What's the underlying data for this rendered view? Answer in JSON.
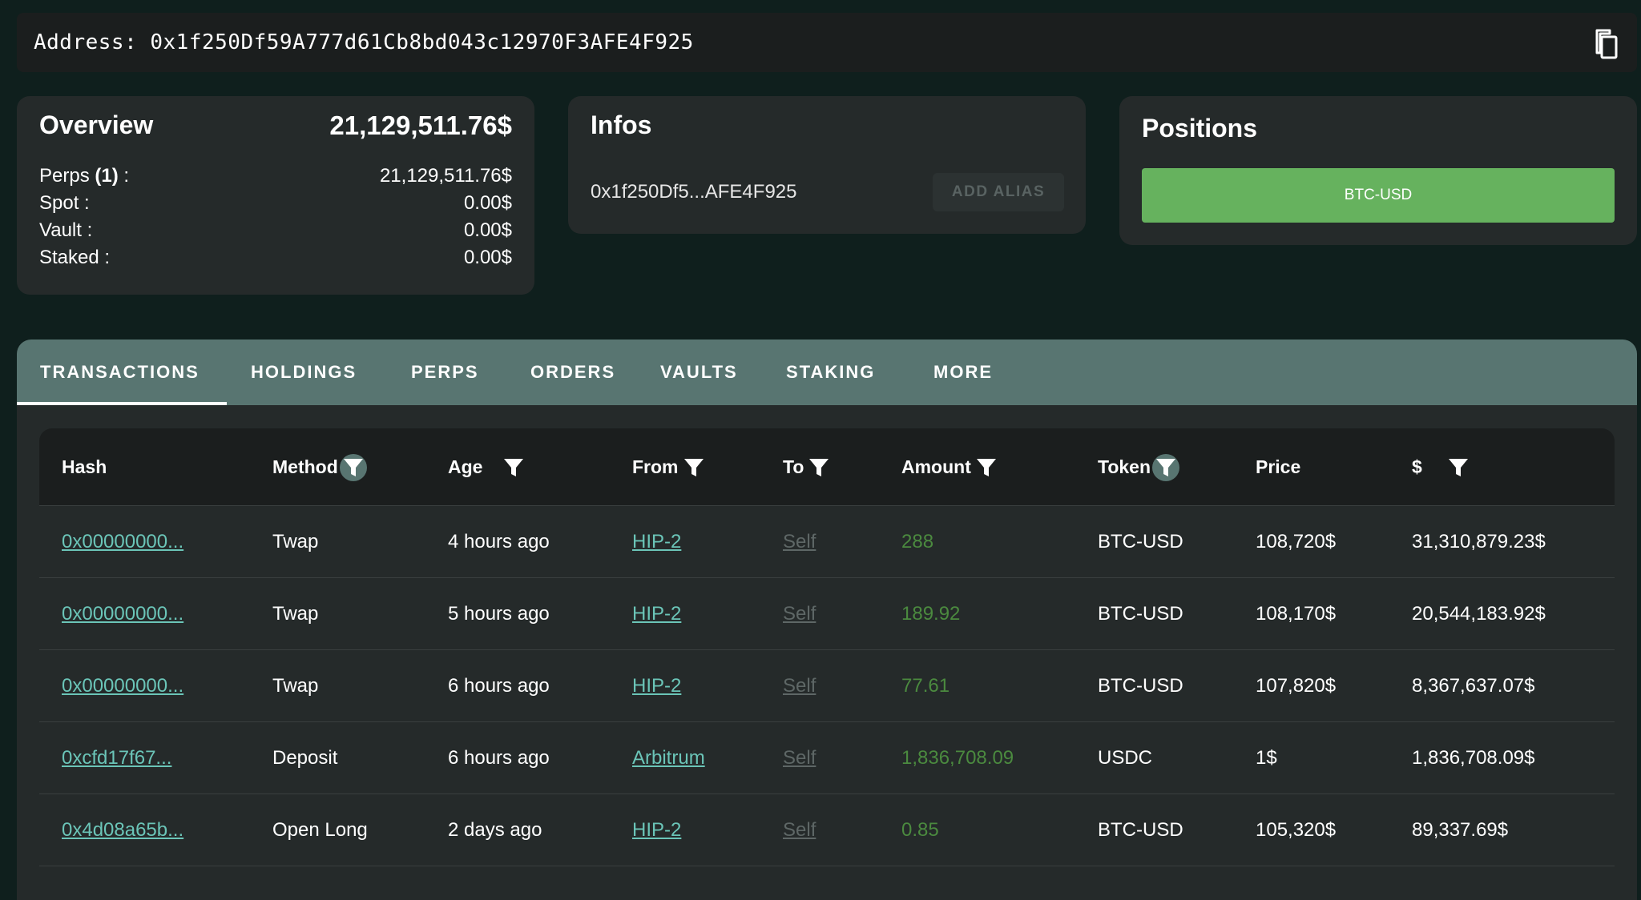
{
  "address": {
    "text": "Address: 0x1f250Df59A777d61Cb8bd043c12970F3AFE4F925",
    "copy_icon": "copy-icon"
  },
  "overview": {
    "title": "Overview",
    "total": "21,129,511.76$",
    "rows": [
      {
        "label": "Perps ",
        "count": "(1)",
        "suffix": " :",
        "value": "21,129,511.76$"
      },
      {
        "label": "Spot :",
        "value": "0.00$"
      },
      {
        "label": "Vault :",
        "value": "0.00$"
      },
      {
        "label": "Staked :",
        "value": "0.00$"
      }
    ]
  },
  "infos": {
    "title": "Infos",
    "short_address": "0x1f250Df5...AFE4F925",
    "add_alias_label": "ADD ALIAS"
  },
  "positions": {
    "title": "Positions",
    "items": [
      "BTC-USD"
    ],
    "accent": "#66b25e"
  },
  "tabs": [
    {
      "label": "TRANSACTIONS",
      "active": true
    },
    {
      "label": "HOLDINGS"
    },
    {
      "label": "PERPS"
    },
    {
      "label": "ORDERS"
    },
    {
      "label": "VAULTS"
    },
    {
      "label": "STAKING"
    },
    {
      "label": "MORE"
    }
  ],
  "table": {
    "columns": [
      {
        "label": "Hash"
      },
      {
        "label": "Method",
        "filter": "active"
      },
      {
        "label": "Age",
        "filter": "inactive"
      },
      {
        "label": "From",
        "filter": "inactive"
      },
      {
        "label": "To",
        "filter": "inactive"
      },
      {
        "label": "Amount",
        "filter": "inactive"
      },
      {
        "label": "Token",
        "filter": "active"
      },
      {
        "label": "Price"
      },
      {
        "label": "$",
        "filter": "inactive"
      }
    ],
    "rows": [
      {
        "hash": "0x00000000...",
        "method": "Twap",
        "age": "4 hours ago",
        "from": "HIP-2",
        "to": "Self",
        "amount": "288",
        "token": "BTC-USD",
        "price": "108,720$",
        "usd": "31,310,879.23$"
      },
      {
        "hash": "0x00000000...",
        "method": "Twap",
        "age": "5 hours ago",
        "from": "HIP-2",
        "to": "Self",
        "amount": "189.92",
        "token": "BTC-USD",
        "price": "108,170$",
        "usd": "20,544,183.92$"
      },
      {
        "hash": "0x00000000...",
        "method": "Twap",
        "age": "6 hours ago",
        "from": "HIP-2",
        "to": "Self",
        "amount": "77.61",
        "token": "BTC-USD",
        "price": "107,820$",
        "usd": "8,367,637.07$"
      },
      {
        "hash": "0xcfd17f67...",
        "method": "Deposit",
        "age": "6 hours ago",
        "from": "Arbitrum",
        "to": "Self",
        "amount": "1,836,708.09",
        "token": "USDC",
        "price": "1$",
        "usd": "1,836,708.09$"
      },
      {
        "hash": "0x4d08a65b...",
        "method": "Open Long",
        "age": "2 days ago",
        "from": "HIP-2",
        "to": "Self",
        "amount": "0.85",
        "token": "BTC-USD",
        "price": "105,320$",
        "usd": "89,337.69$"
      }
    ]
  },
  "colors": {
    "background": "#0f1f1d",
    "card": "#252a2a",
    "tabbar": "#587571",
    "link": "#6bc5b8",
    "amount": "#4b8a3f"
  }
}
